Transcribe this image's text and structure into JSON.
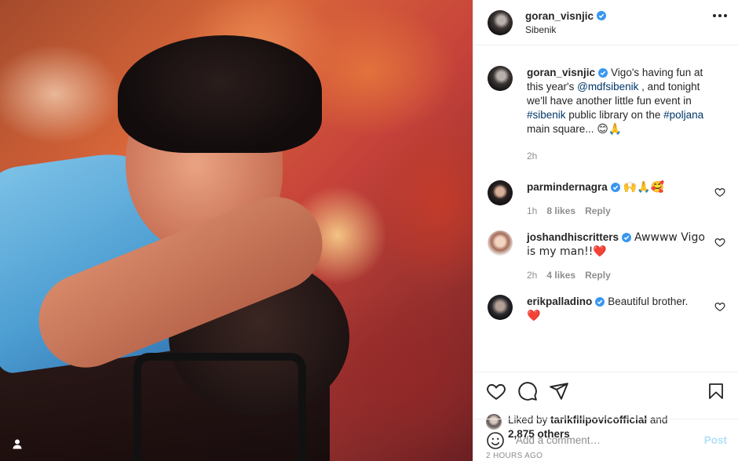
{
  "post": {
    "username": "goran_visnjic",
    "location": "Sibenik",
    "verified_color": "#3897f0"
  },
  "caption": {
    "username": "goran_visnjic",
    "text_1": "Vigo's having fun at this year's ",
    "mention": "@mdfsibenik",
    "text_2": " , and tonight we'll have another little fun event in ",
    "hashtag_1": "#sibenik",
    "text_3": " public library on the ",
    "hashtag_2": "#poljana",
    "text_4": " main square... ",
    "emoji": "😊🙏",
    "time": "2h"
  },
  "comments": [
    {
      "username": "parmindernagra",
      "text": "🙌🙏🥰",
      "time": "1h",
      "likes": "8 likes",
      "reply": "Reply"
    },
    {
      "username": "joshandhiscritters",
      "text": "Awwww Vigo is my man!!❤️",
      "time": "2h",
      "likes": "4 likes",
      "reply": "Reply"
    },
    {
      "username": "erikpalladino",
      "text": "Beautiful brother.",
      "extra": "❤️"
    }
  ],
  "likes_section": {
    "prefix": "Liked by ",
    "user": "tarikfilipovicofficial",
    "and": " and",
    "others": "2,875 others",
    "timeago": "2 HOURS AGO"
  },
  "add_comment": {
    "placeholder": "Add a comment…",
    "post_label": "Post"
  },
  "icons": {
    "heart": "heart-icon",
    "comment": "comment-icon",
    "share": "share-icon",
    "save": "bookmark-icon",
    "emoji": "emoji-icon",
    "more": "more-icon",
    "tag": "user-tag-icon"
  }
}
